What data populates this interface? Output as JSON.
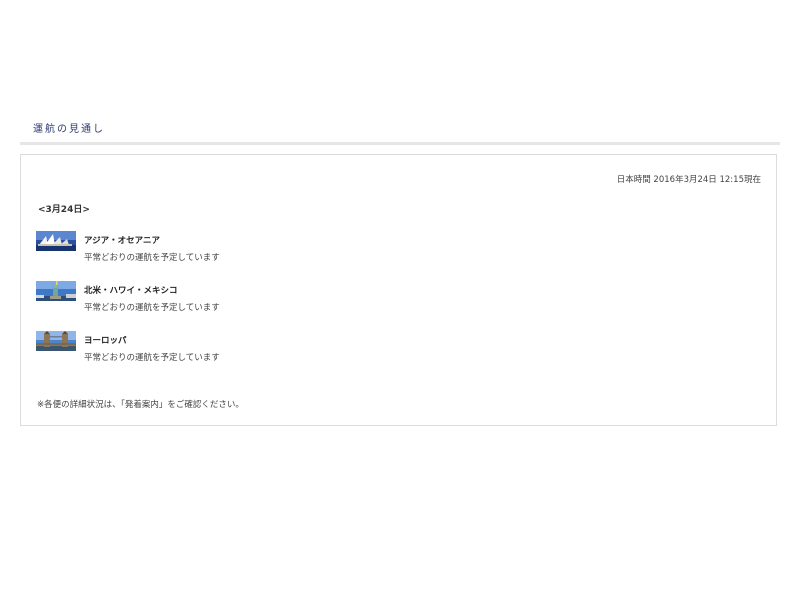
{
  "section": {
    "title": "運航の見通し"
  },
  "panel": {
    "timestamp": "日本時間 2016年3月24日 12:15現在",
    "date_heading": "<3月24日>",
    "regions": [
      {
        "name": "アジア・オセアニア",
        "status": "平常どおりの運航を予定しています",
        "icon": "sydney-opera-house-photo"
      },
      {
        "name": "北米・ハワイ・メキシコ",
        "status": "平常どおりの運航を予定しています",
        "icon": "statue-of-liberty-photo"
      },
      {
        "name": "ヨーロッパ",
        "status": "平常どおりの運航を予定しています",
        "icon": "tower-bridge-photo"
      }
    ],
    "note": "※各便の詳細状況は、「発着案内」をご確認ください。"
  },
  "colors": {
    "title_text": "#2e3a73",
    "rule": "#e6e6e6",
    "panel_border": "#dcdcdc"
  }
}
